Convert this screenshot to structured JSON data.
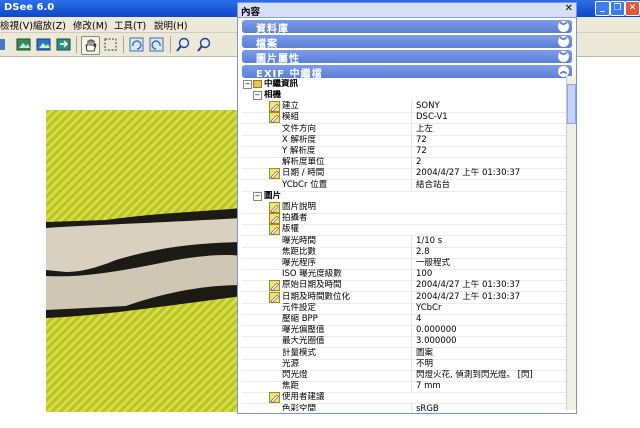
{
  "window": {
    "title": "DSee 6.0"
  },
  "menu": [
    "檢視(V)",
    "縮放(Z)",
    "修改(M)",
    "工具(T)",
    "說明(H)"
  ],
  "panel": {
    "title": "內容",
    "sections": [
      "資料庫",
      "檔案",
      "圖片屬性",
      "EXIF 中繼檔"
    ]
  },
  "exif": {
    "root": "中繼資訊",
    "groups": [
      {
        "label": "相機",
        "rows": [
          {
            "k": "建立",
            "v": "SONY",
            "pen": true
          },
          {
            "k": "模組",
            "v": "DSC-V1",
            "pen": true
          },
          {
            "k": "文件方向",
            "v": "上左",
            "pen": false
          },
          {
            "k": "X 解析度",
            "v": "72",
            "pen": false
          },
          {
            "k": "Y 解析度",
            "v": "72",
            "pen": false
          },
          {
            "k": "解析度單位",
            "v": "2",
            "pen": false
          },
          {
            "k": "日期 / 時間",
            "v": "2004/4/27 上午 01:30:37",
            "pen": true
          },
          {
            "k": "YCbCr 位置",
            "v": "結合站台",
            "pen": false
          }
        ]
      },
      {
        "label": "圖片",
        "rows": [
          {
            "k": "圖片說明",
            "v": "",
            "pen": true
          },
          {
            "k": "拍攝者",
            "v": "",
            "pen": true
          },
          {
            "k": "版權",
            "v": "",
            "pen": true
          },
          {
            "k": "曝光時間",
            "v": "1/10 s",
            "pen": false
          },
          {
            "k": "焦距比數",
            "v": "2.8",
            "pen": false
          },
          {
            "k": "曝光程序",
            "v": "一般程式",
            "pen": false
          },
          {
            "k": "ISO 曝光度級數",
            "v": "100",
            "pen": false
          },
          {
            "k": "原始日期及時間",
            "v": "2004/4/27 上午 01:30:37",
            "pen": true
          },
          {
            "k": "日期及時間數位化",
            "v": "2004/4/27 上午 01:30:37",
            "pen": true
          },
          {
            "k": "元件設定",
            "v": "YCbCr",
            "pen": false
          },
          {
            "k": "壓縮 BPP",
            "v": "4",
            "pen": false
          },
          {
            "k": "曝光偏壓值",
            "v": "0.000000",
            "pen": false
          },
          {
            "k": "最大光圈值",
            "v": "3.000000",
            "pen": false
          },
          {
            "k": "計量模式",
            "v": "圖案",
            "pen": false
          },
          {
            "k": "光源",
            "v": "不明",
            "pen": false
          },
          {
            "k": "閃光燈",
            "v": "閃燈火花, 偵測到閃光燈。 [閃]",
            "pen": false
          },
          {
            "k": "焦距",
            "v": "7 mm",
            "pen": false
          },
          {
            "k": "使用者建議",
            "v": "",
            "pen": true
          },
          {
            "k": "色彩空間",
            "v": "sRGB",
            "pen": false
          }
        ]
      }
    ]
  },
  "colors": {
    "titlebar": "#0b47c7",
    "section": "#5a7fd6",
    "panel_header": "#d6dff7",
    "fabric": "#d8e23a"
  }
}
